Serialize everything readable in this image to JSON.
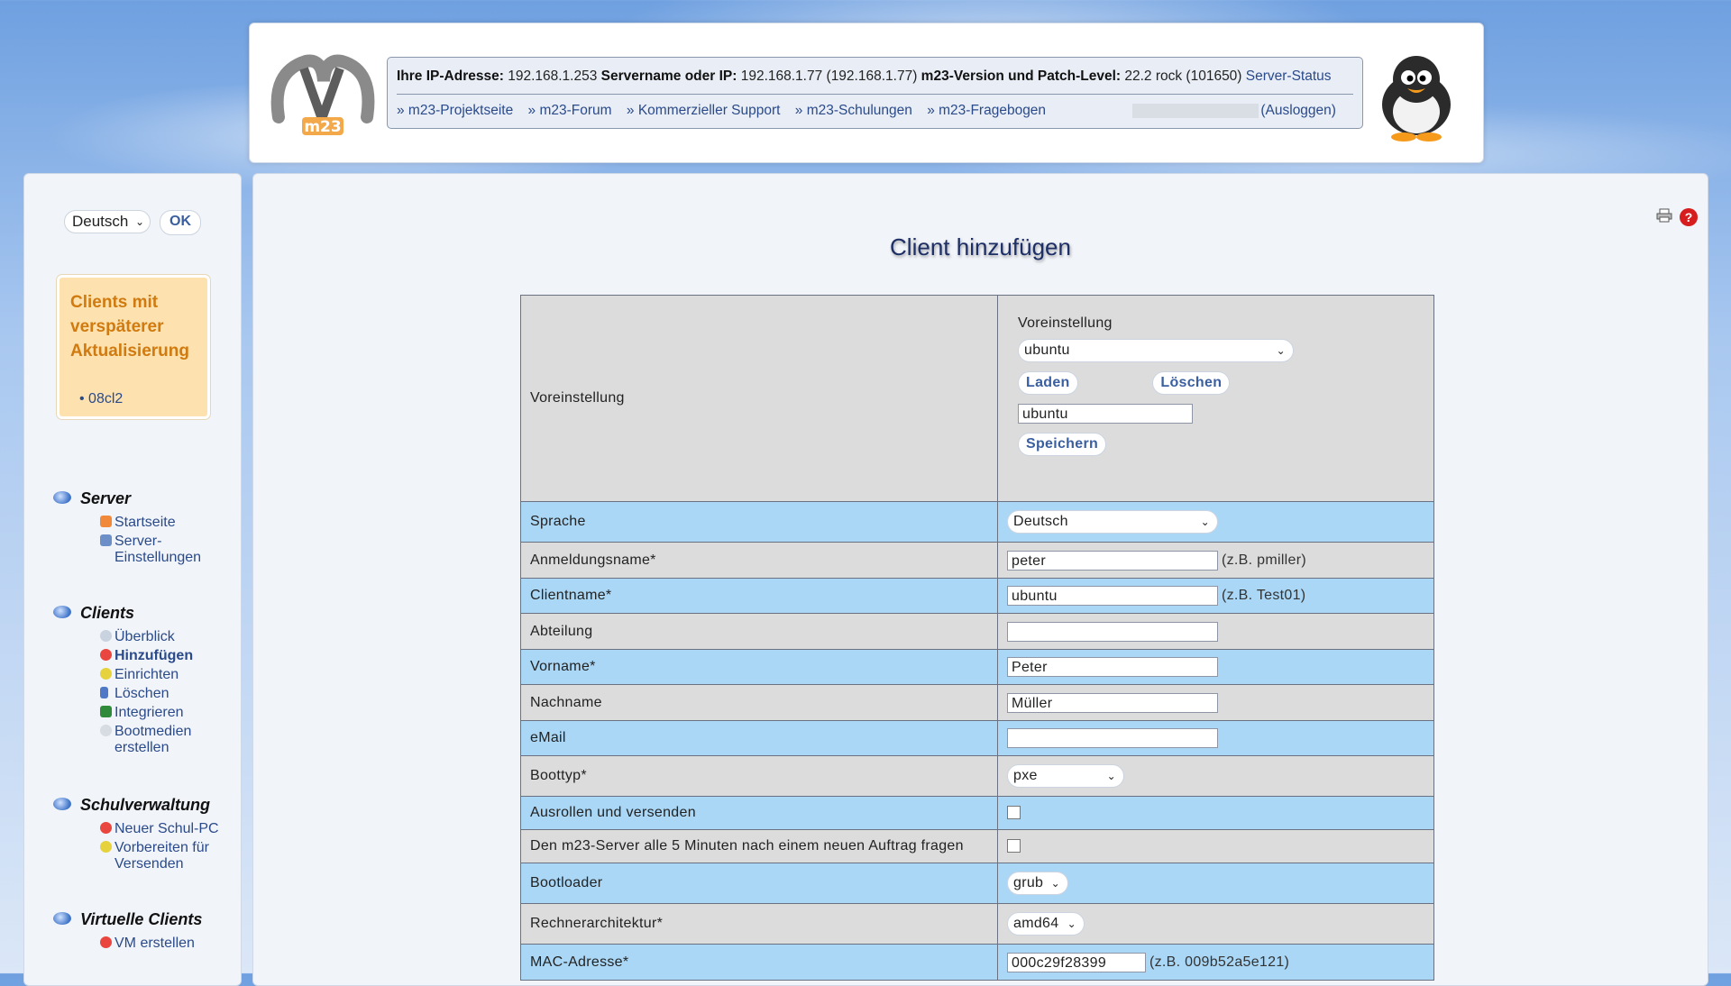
{
  "header": {
    "ip_label": "Ihre IP-Adresse:",
    "ip_value": "192.168.1.253",
    "server_label": "Servername oder IP:",
    "server_value": "192.168.1.77 (192.168.1.77)",
    "version_label": "m23-Version und Patch-Level:",
    "version_value": "22.2 rock (101650)",
    "server_status_link": "Server-Status",
    "links": [
      "» m23-Projektseite",
      "» m23-Forum",
      "» Kommerzieller Support",
      "» m23-Schulungen",
      "» m23-Fragebogen"
    ],
    "logout_label": "(Ausloggen)",
    "logo_text": "m23"
  },
  "sidebar": {
    "language_value": "Deutsch",
    "ok_label": "OK",
    "late_box": {
      "title": "Clients mit verspäterer Aktualisierung",
      "items": [
        "• 08cl2"
      ]
    },
    "sections": [
      {
        "title": "Server",
        "items": [
          {
            "label": "Startseite",
            "icon": "home-icon"
          },
          {
            "label": "Server-Einstellungen",
            "icon": "server-settings-icon"
          }
        ]
      },
      {
        "title": "Clients",
        "items": [
          {
            "label": "Überblick",
            "icon": "magnifier-icon"
          },
          {
            "label": "Hinzufügen",
            "icon": "add-client-icon"
          },
          {
            "label": "Einrichten",
            "icon": "setup-icon"
          },
          {
            "label": "Löschen",
            "icon": "delete-icon"
          },
          {
            "label": "Integrieren",
            "icon": "integrate-icon"
          },
          {
            "label": "Bootmedien erstellen",
            "icon": "bootmedia-icon"
          }
        ]
      },
      {
        "title": "Schulverwaltung",
        "items": [
          {
            "label": "Neuer Schul-PC",
            "icon": "new-pc-icon"
          },
          {
            "label": "Vorbereiten für Versenden",
            "icon": "prepare-icon"
          }
        ]
      },
      {
        "title": "Virtuelle Clients",
        "items": [
          {
            "label": "VM erstellen",
            "icon": "vm-create-icon"
          }
        ]
      }
    ]
  },
  "main": {
    "title": "Client hinzufügen",
    "preset": {
      "row_label": "Voreinstellung",
      "inner_label": "Voreinstellung",
      "select_value": "ubuntu",
      "load_label": "Laden",
      "delete_label": "Löschen",
      "name_value": "ubuntu",
      "save_label": "Speichern"
    },
    "rows": {
      "language": {
        "label": "Sprache",
        "value": "Deutsch"
      },
      "login": {
        "label": "Anmeldungsname*",
        "value": "peter",
        "hint": "(z.B. pmiller)"
      },
      "clientname": {
        "label": "Clientname*",
        "value": "ubuntu",
        "hint": "(z.B. Test01)"
      },
      "department": {
        "label": "Abteilung",
        "value": ""
      },
      "firstname": {
        "label": "Vorname*",
        "value": "Peter"
      },
      "lastname": {
        "label": "Nachname",
        "value": "Müller"
      },
      "email": {
        "label": "eMail",
        "value": ""
      },
      "boottype": {
        "label": "Boottyp*",
        "value": "pxe"
      },
      "rollout": {
        "label": "Ausrollen und versenden",
        "checked": false
      },
      "poll": {
        "label": "Den m23-Server alle 5 Minuten nach einem neuen Auftrag fragen",
        "checked": false
      },
      "bootloader": {
        "label": "Bootloader",
        "value": "grub"
      },
      "arch": {
        "label": "Rechnerarchitektur*",
        "value": "amd64"
      },
      "mac": {
        "label": "MAC-Adresse*",
        "value": "000c29f28399",
        "hint": "(z.B. 009b52a5e121)"
      }
    }
  },
  "colors": {
    "row_blue": "#aad7f6",
    "row_grey": "#dcdcdc",
    "late_box_bg": "#fde2b0",
    "late_box_title": "#d07a10",
    "link": "#2a4a8a",
    "title": "#1d2f66"
  }
}
